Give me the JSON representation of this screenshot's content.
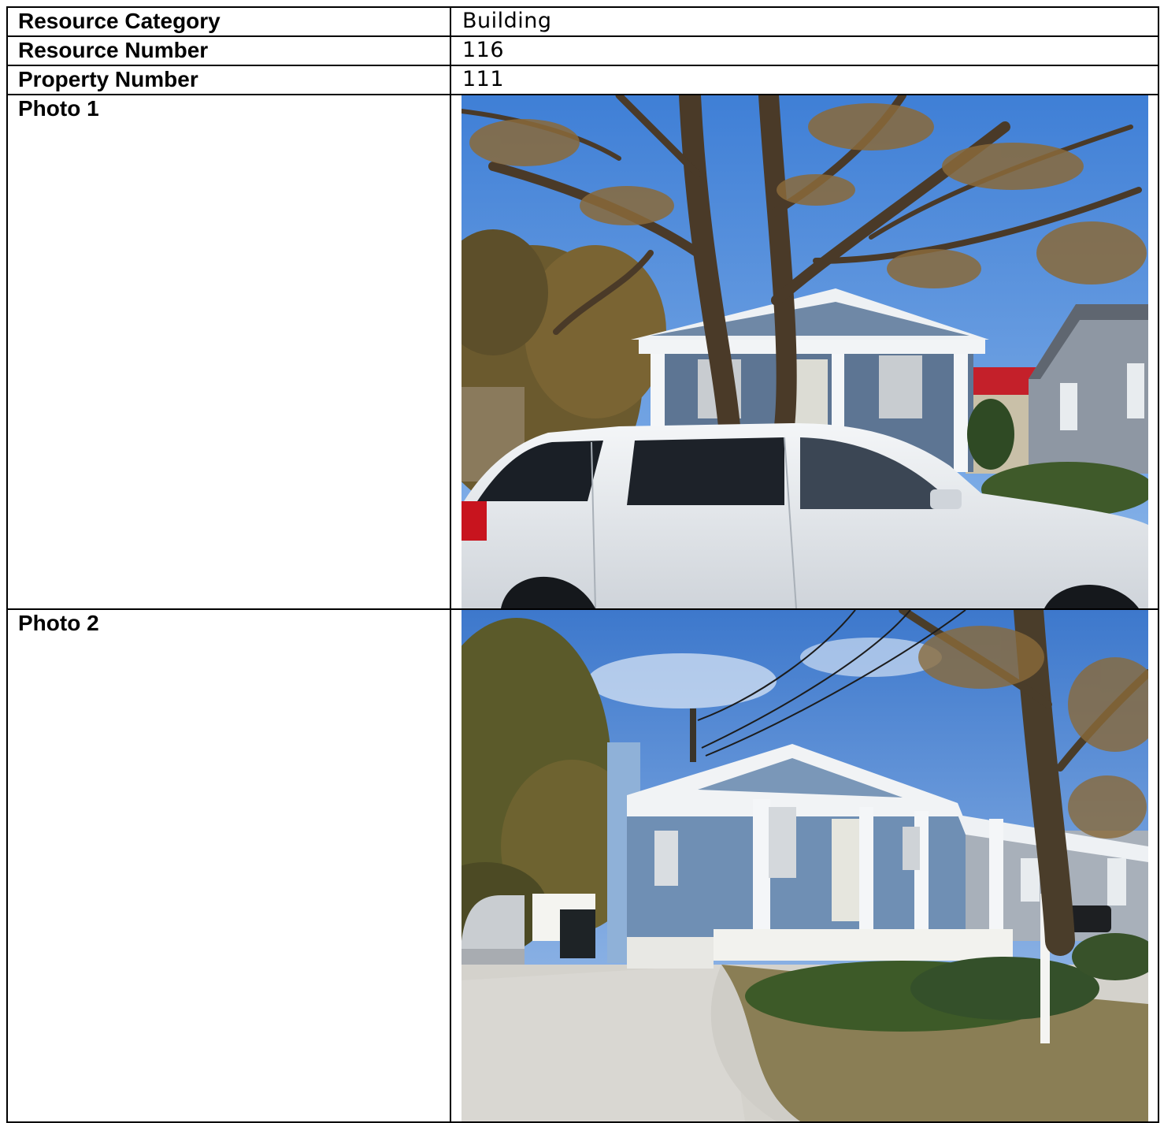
{
  "rows": {
    "category": {
      "label": "Resource Category",
      "value": "Building"
    },
    "resource_number": {
      "label": "Resource Number",
      "value": "116"
    },
    "property_number": {
      "label": "Property Number",
      "value": "111"
    },
    "photo1": {
      "label": "Photo 1"
    },
    "photo2": {
      "label": "Photo 2"
    }
  }
}
